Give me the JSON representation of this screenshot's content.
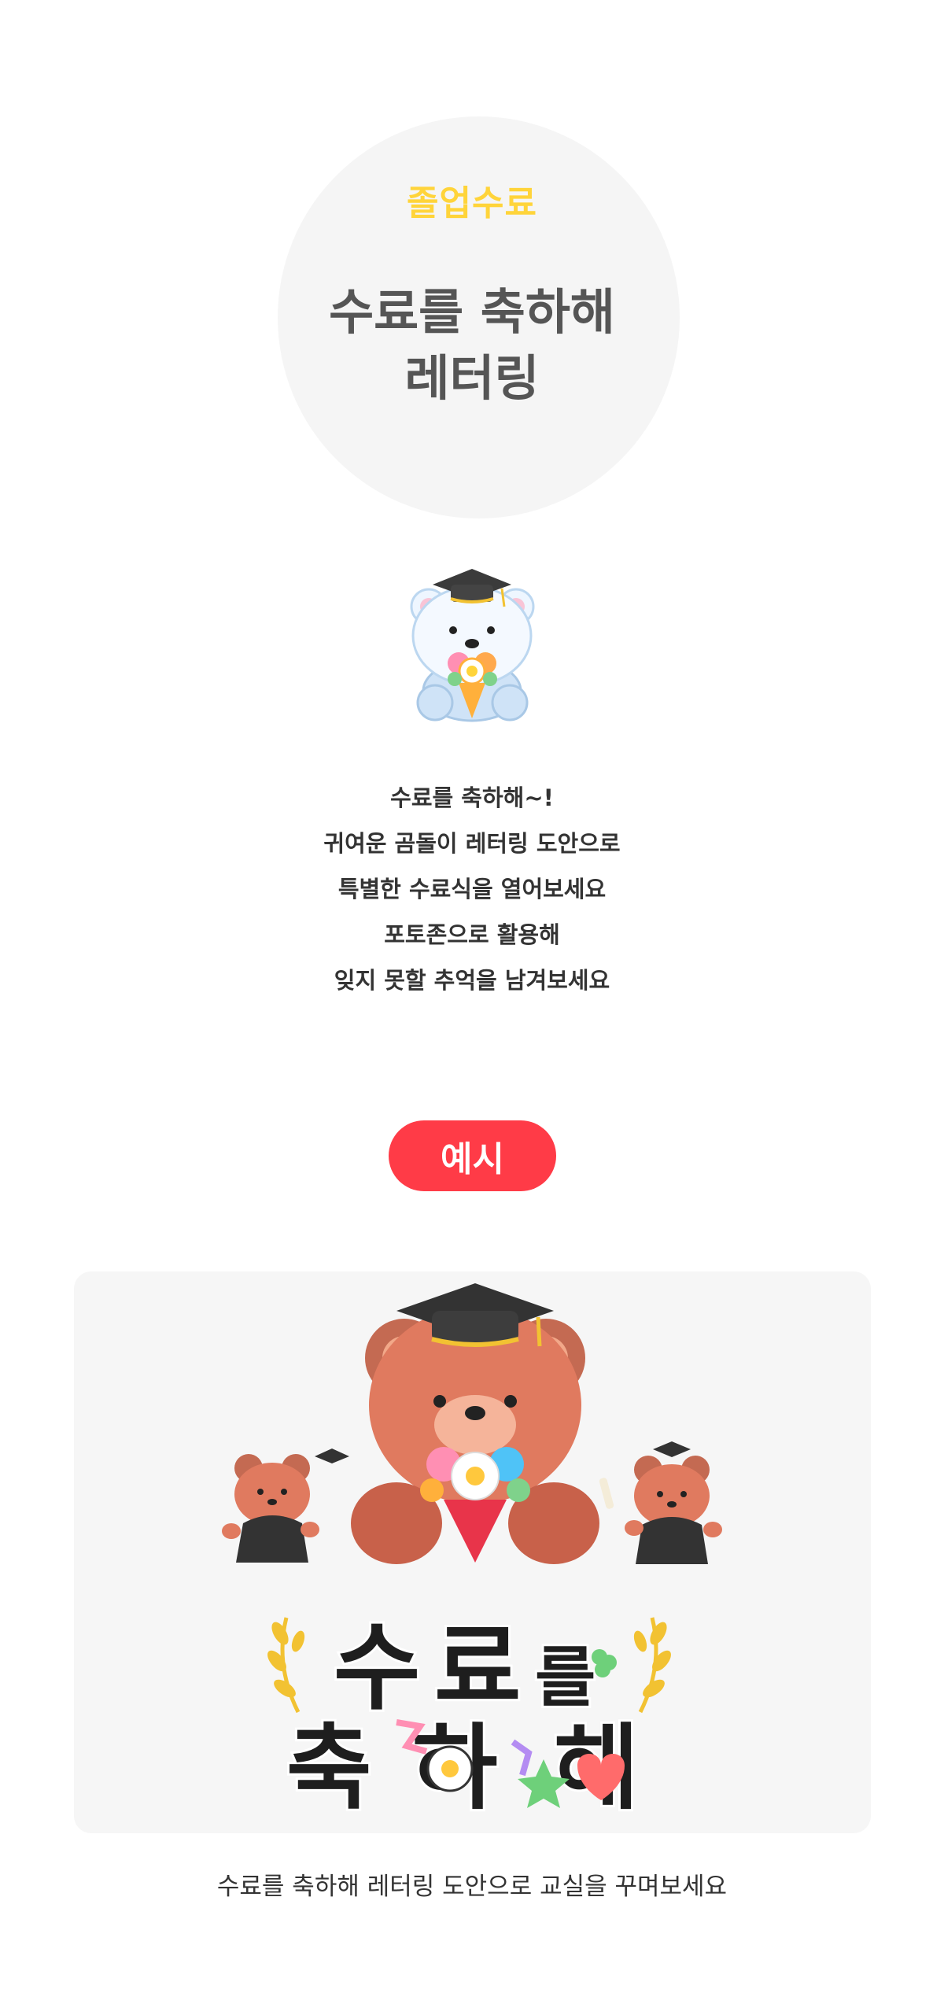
{
  "hero": {
    "badge": "졸업수료",
    "title_line1": "수료를 축하해",
    "title_line2": "레터링"
  },
  "description": [
    "수료를 축하해~!",
    "귀여운 곰돌이 레터링 도안으로",
    "특별한 수료식을 열어보세요",
    "포토존으로 활용해",
    "잊지 못할 추억을 남겨보세요"
  ],
  "example_button": "예시",
  "lettering": {
    "char1": "수",
    "char2": "료",
    "char3": "를",
    "char4": "축",
    "char5": "하",
    "char6": "해"
  },
  "caption": "수료를 축하해 레터링 도안으로 교실을 꾸며보세요",
  "colors": {
    "badge_yellow": "#ffd43a",
    "title_gray": "#555555",
    "button_red": "#ff3b47",
    "panel_bg": "#f6f6f6"
  }
}
